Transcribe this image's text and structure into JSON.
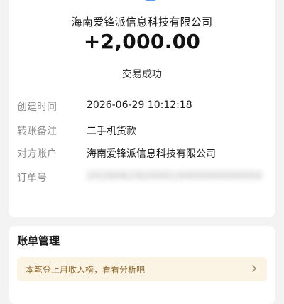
{
  "transaction": {
    "merchant": "海南爱锋派信息科技有限公司",
    "amount": "+2,000.00",
    "status": "交易成功"
  },
  "details": [
    {
      "label": "创建时间",
      "value": "2026-06-29 10:12:18"
    },
    {
      "label": "转账备注",
      "value": "二手机货款"
    },
    {
      "label": "对方账户",
      "value": "海南爱锋派信息科技有限公司"
    },
    {
      "label": "订单号",
      "value": "2026062920001000000000050"
    }
  ],
  "bill_management": {
    "title": "账单管理",
    "hint": "本笔登上月收入榜，看看分析吧"
  },
  "icons": {
    "avatar": "merchant-avatar-icon",
    "chevron": "chevron-right-icon"
  },
  "colors": {
    "avatar": "#5a9af7",
    "hint_bg": "#fbf4e4",
    "hint_text": "#8d6a32"
  }
}
